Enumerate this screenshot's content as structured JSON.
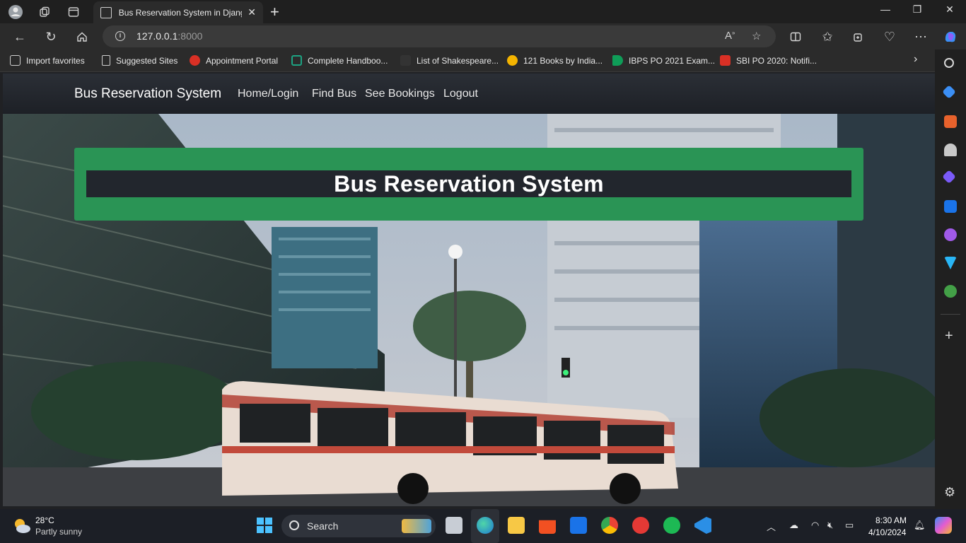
{
  "browser": {
    "tab_title": "Bus Reservation System in Djang",
    "url_host": "127.0.0.1",
    "url_port": ":8000"
  },
  "bookmarks": [
    {
      "label": "Import favorites"
    },
    {
      "label": "Suggested Sites"
    },
    {
      "label": "Appointment Portal"
    },
    {
      "label": "Complete Handboo..."
    },
    {
      "label": "List of Shakespeare..."
    },
    {
      "label": "121 Books by India..."
    },
    {
      "label": "IBPS PO 2021 Exam..."
    },
    {
      "label": "SBI PO 2020: Notifi..."
    }
  ],
  "site": {
    "brand": "Bus Reservation System",
    "nav": [
      "Home/Login",
      "Find Bus",
      "See Bookings",
      "Logout"
    ],
    "hero_title": "Bus Reservation System",
    "banner_color": "#2a9455"
  },
  "taskbar": {
    "weather_temp": "28°C",
    "weather_desc": "Partly sunny",
    "search_label": "Search",
    "time": "8:30 AM",
    "date": "4/10/2024"
  }
}
